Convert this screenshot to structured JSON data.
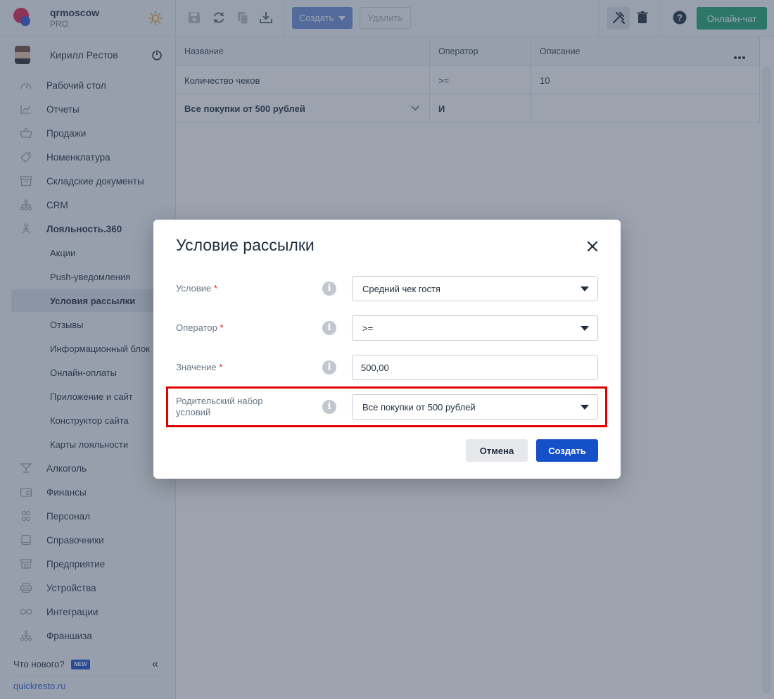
{
  "brand": {
    "name": "qrmoscow",
    "plan": "PRO"
  },
  "user": {
    "name": "Кирилл Рестов"
  },
  "sidebar": {
    "items": [
      {
        "label": "Рабочий стол",
        "icon": "dashboard-icon"
      },
      {
        "label": "Отчеты",
        "icon": "reports-chart-icon"
      },
      {
        "label": "Продажи",
        "icon": "basket-icon"
      },
      {
        "label": "Номенклатура",
        "icon": "tag-icon"
      },
      {
        "label": "Складские документы",
        "icon": "archive-box-icon"
      },
      {
        "label": "CRM",
        "icon": "crm-tree-icon"
      },
      {
        "label": "Лояльность.360",
        "icon": "loyalty-icon"
      },
      {
        "label": "Акции"
      },
      {
        "label": "Push-уведомления"
      },
      {
        "label": "Условия рассылки"
      },
      {
        "label": "Отзывы"
      },
      {
        "label": "Информационный блок"
      },
      {
        "label": "Онлайн-оплаты"
      },
      {
        "label": "Приложение и сайт"
      },
      {
        "label": "Конструктор сайта"
      },
      {
        "label": "Карты лояльности"
      },
      {
        "label": "Алкоголь",
        "icon": "cocktail-glass-icon"
      },
      {
        "label": "Финансы",
        "icon": "wallet-icon"
      },
      {
        "label": "Персонал",
        "icon": "people-icon"
      },
      {
        "label": "Справочники",
        "icon": "book-icon"
      },
      {
        "label": "Предприятие",
        "icon": "storefront-icon"
      },
      {
        "label": "Устройства",
        "icon": "printer-icon"
      },
      {
        "label": "Интеграции",
        "icon": "infinity-icon"
      },
      {
        "label": "Франшиза",
        "icon": "franchise-tree-icon"
      }
    ],
    "whats_new": "Что нового?",
    "new_badge": "NEW",
    "site_link": "quickresto.ru"
  },
  "toolbar": {
    "create_label": "Создать",
    "delete_label": "Удалить",
    "chat_label": "Онлайн-чат"
  },
  "table": {
    "columns": [
      "Название",
      "Оператор",
      "Описание"
    ],
    "rows": [
      {
        "name": "Количество чеков",
        "operator": ">=",
        "description": "10"
      },
      {
        "name": "Все покупки от 500 рублей",
        "operator": "И",
        "description": ""
      }
    ]
  },
  "modal": {
    "title": "Условие рассылки",
    "fields": {
      "condition": {
        "label": "Условие",
        "required": "*",
        "value": "Средний чек гостя"
      },
      "operator": {
        "label": "Оператор",
        "required": "*",
        "value": ">="
      },
      "value": {
        "label": "Значение",
        "required": "*",
        "value": "500,00"
      },
      "parent": {
        "label": "Родительский набор условий",
        "value": "Все покупки от 500 рублей"
      }
    },
    "cancel_label": "Отмена",
    "submit_label": "Создать"
  },
  "colors": {
    "primary": "#1451c8",
    "chat_green": "#21a672",
    "highlight_red": "#e00000",
    "required_red": "#e02020"
  }
}
